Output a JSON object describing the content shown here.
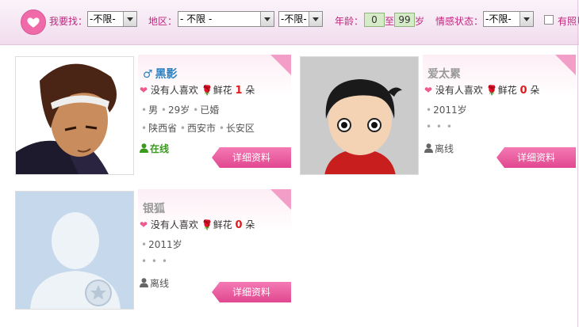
{
  "search": {
    "find_label": "我要找：",
    "find_value": "-不限-",
    "region_label": "地区：",
    "region_value": "- 不限 -",
    "region2_value": "-不限-",
    "age_label": "年龄：",
    "age_min": "0",
    "age_to": "至",
    "age_max": "99",
    "age_unit": "岁",
    "emotion_label": "情感状态：",
    "emotion_value": "-不限-",
    "photo_label": "有照片"
  },
  "cards": [
    {
      "gender_symbol": "♂",
      "name": "黑影",
      "no_likes": "没有人喜欢",
      "flower_label": "鲜花",
      "flower_count": "1",
      "flower_unit": "朵",
      "line1": [
        "男",
        "29岁",
        "已婚"
      ],
      "line2": [
        "陕西省",
        "西安市",
        "长安区"
      ],
      "status": "在线",
      "detail_button": "详细资料"
    },
    {
      "name": "爱太累",
      "no_likes": "没有人喜欢",
      "flower_label": "鲜花",
      "flower_count": "0",
      "flower_unit": "朵",
      "line1": [
        "2011岁"
      ],
      "line2": [
        "",
        "",
        ""
      ],
      "status": "离线",
      "detail_button": "详细资料"
    },
    {
      "name": "银狐",
      "no_likes": "没有人喜欢",
      "flower_label": "鲜花",
      "flower_count": "0",
      "flower_unit": "朵",
      "line1": [
        "2011岁"
      ],
      "line2": [
        "",
        "",
        ""
      ],
      "status": "离线",
      "detail_button": "详细资料"
    }
  ],
  "colors": {
    "accent_pink": "#e1478f",
    "label_magenta": "#c0287e",
    "name_blue": "#2e7fbd",
    "online_green": "#3a9a1e",
    "flower_red": "#e01b1b"
  }
}
